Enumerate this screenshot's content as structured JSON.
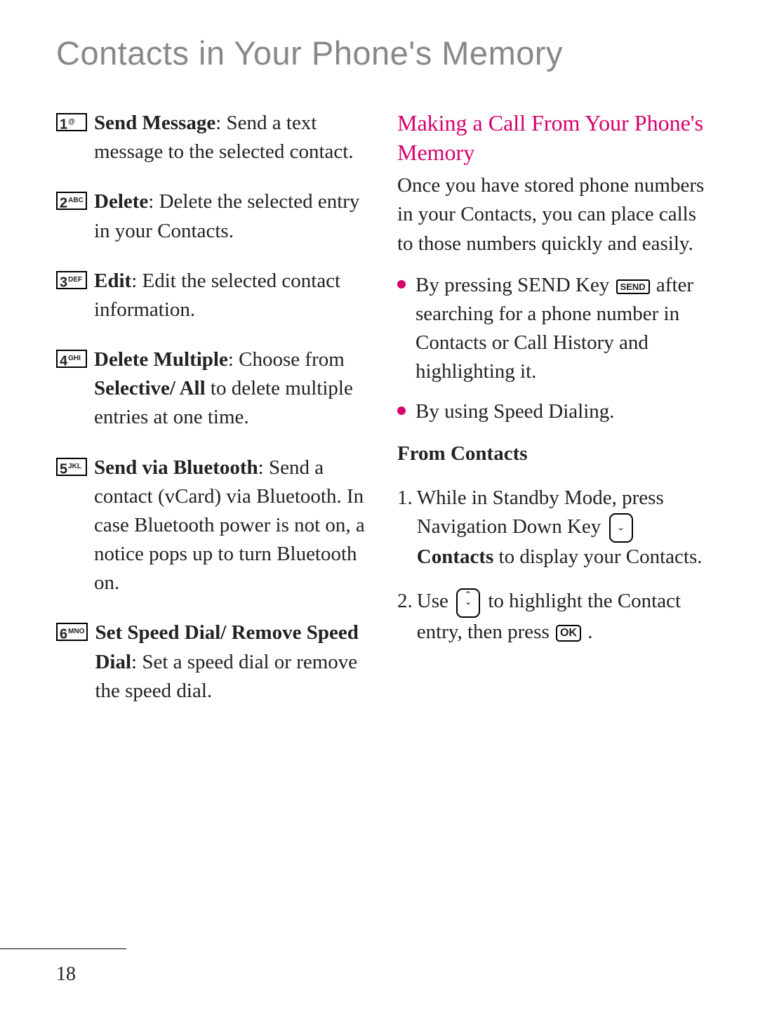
{
  "title": "Contacts in Your Phone's Memory",
  "page_num": "18",
  "keys": {
    "k1": {
      "num": "1",
      "sup": "@"
    },
    "k2": {
      "num": "2",
      "sup": "ABC"
    },
    "k3": {
      "num": "3",
      "sup": "DEF"
    },
    "k4": {
      "num": "4",
      "sup": "GHI"
    },
    "k5": {
      "num": "5",
      "sup": "JKL"
    },
    "k6": {
      "num": "6",
      "sup": "MNO"
    }
  },
  "left": {
    "i1": {
      "label": "Send Message",
      "body": ": Send a text message to the selected contact."
    },
    "i2": {
      "label": "Delete",
      "body": ": Delete the selected entry in your Contacts."
    },
    "i3": {
      "label": "Edit",
      "body": ": Edit the selected contact information."
    },
    "i4": {
      "label": "Delete Multiple",
      "body_a": ": Choose from ",
      "body_b": "Selective/ All",
      "body_c": " to delete multiple entries at one time."
    },
    "i5": {
      "label": "Send via Bluetooth",
      "body": ": Send a contact (vCard) via Bluetooth. In case Bluetooth power is not on, a notice pops up to turn Bluetooth on."
    },
    "i6": {
      "label": "Set Speed Dial/ Remove Speed Dial",
      "body": ": Set a speed dial or remove the speed dial."
    }
  },
  "right": {
    "heading": "Making a Call From Your Phone's Memory",
    "intro": "Once you have stored phone numbers in your Contacts, you can place calls to those numbers quickly and easily.",
    "b1_a": "By pressing SEND Key ",
    "b1_b": " after searching for a phone number in Contacts or Call History and highlighting it.",
    "b2": "By using Speed Dialing.",
    "sub": "From Contacts",
    "s1_a": "While in Standby Mode, press Navigation Down Key ",
    "s1_b": "Contacts",
    "s1_c": " to display your Contacts.",
    "s2_a": "Use ",
    "s2_b": " to highlight the Contact entry, then press ",
    "s2_c": " .",
    "send_label": "SEND",
    "ok_label": "OK",
    "num1": "1.",
    "num2": "2."
  }
}
